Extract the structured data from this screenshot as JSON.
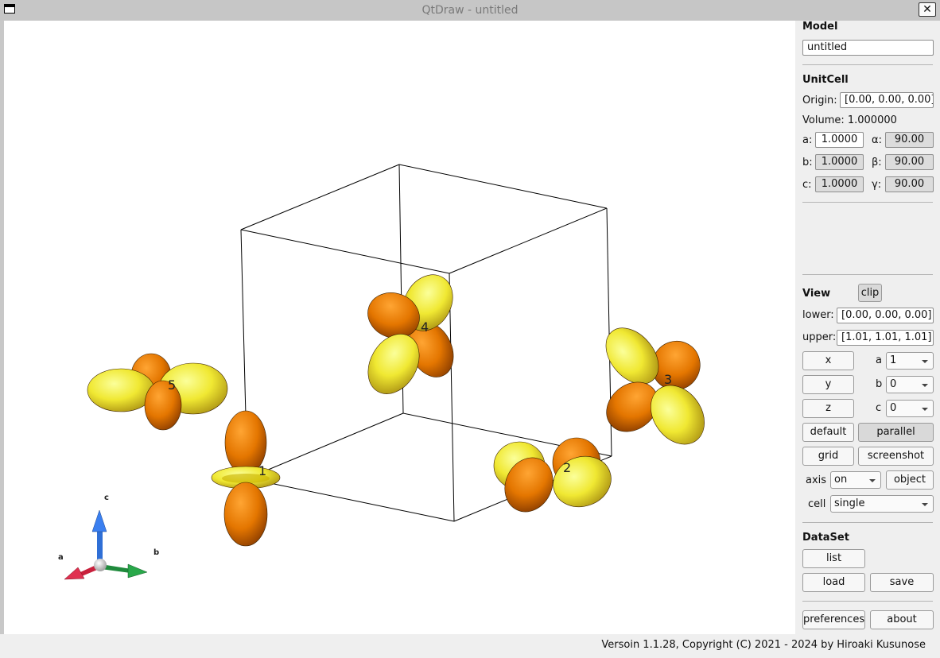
{
  "window": {
    "title": "QtDraw - untitled",
    "close_glyph": "✕"
  },
  "viewport": {
    "atom_labels": [
      "1",
      "2",
      "3",
      "4",
      "5"
    ],
    "axis_labels": {
      "a": "a",
      "b": "b",
      "c": "c"
    },
    "colors": {
      "orbital_dark": "#e07000",
      "orbital_light": "#f4f040",
      "axis_a": "#c8203c",
      "axis_b": "#1f8a3c",
      "axis_c": "#2f6fd6"
    }
  },
  "panel": {
    "model": {
      "heading": "Model",
      "name": "untitled"
    },
    "unitcell": {
      "heading": "UnitCell",
      "origin_label": "Origin:",
      "origin_value": "[0.00,  0.00,  0.00]",
      "volume_text": "Volume: 1.000000",
      "a_label": "a:",
      "a_value": "1.0000",
      "b_label": "b:",
      "b_value": "1.0000",
      "c_label": "c:",
      "c_value": "1.0000",
      "alpha_label": "α:",
      "alpha_value": "90.00",
      "beta_label": "β:",
      "beta_value": "90.00",
      "gamma_label": "γ:",
      "gamma_value": "90.00"
    },
    "view": {
      "heading": "View",
      "clip": "clip",
      "lower_label": "lower:",
      "lower_value": "[0.00,  0.00,  0.00]",
      "upper_label": "upper:",
      "upper_value": "[1.01,  1.01,  1.01]",
      "x": "x",
      "y": "y",
      "z": "z",
      "a_label": "a",
      "a_value": "1",
      "b_label": "b",
      "b_value": "0",
      "c_label": "c",
      "c_value": "0",
      "default": "default",
      "parallel": "parallel",
      "grid": "grid",
      "screenshot": "screenshot",
      "axis_label": "axis",
      "axis_value": "on",
      "object": "object",
      "cell_label": "cell",
      "cell_value": "single"
    },
    "dataset": {
      "heading": "DataSet",
      "list": "list",
      "load": "load",
      "save": "save"
    },
    "preferences": "preferences",
    "about": "about"
  },
  "status": {
    "text": "Versoin 1.1.28, Copyright (C) 2021 - 2024 by Hiroaki Kusunose"
  }
}
